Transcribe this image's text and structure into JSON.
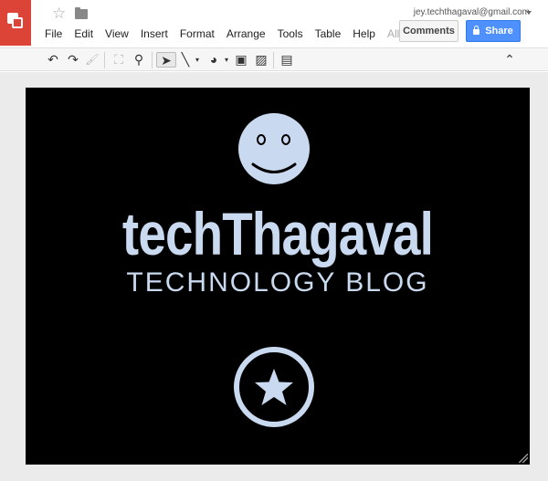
{
  "header": {
    "account": "jey.techthagaval@gmail.com",
    "comments_label": "Comments",
    "share_label": "Share"
  },
  "menu": {
    "file": "File",
    "edit": "Edit",
    "view": "View",
    "insert": "Insert",
    "format": "Format",
    "arrange": "Arrange",
    "tools": "Tools",
    "table": "Table",
    "help": "Help",
    "all": "All ..."
  },
  "toolbar": {
    "icons": [
      "undo-icon",
      "redo-icon",
      "paint-format-icon",
      "fit-icon",
      "zoom-icon",
      "select-icon",
      "line-icon",
      "shape-icon",
      "textbox-icon",
      "image-icon",
      "comment-icon",
      "collapse-icon"
    ]
  },
  "slide": {
    "title": "techThagaval",
    "subtitle": "TECHNOLOGY BLOG",
    "background": "#000000",
    "accent": "#c9daf0"
  },
  "colors": {
    "logo_red": "#db4437",
    "share_blue": "#4d90fe"
  }
}
